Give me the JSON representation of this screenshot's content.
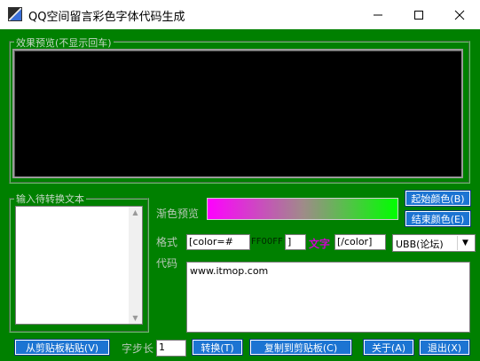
{
  "window": {
    "title": "QQ空间留言彩色字体代码生成",
    "icons": {
      "app": "app-icon",
      "minimize": "minimize-icon",
      "maximize": "maximize-icon",
      "close": "close-icon"
    }
  },
  "preview": {
    "group_label": "效果预览(不显示回车)"
  },
  "input": {
    "group_label": "输入待转换文本"
  },
  "gradient": {
    "label": "渐色预览",
    "start_color": "#ff00ff",
    "end_color": "#00ff00",
    "start_button": "起始颜色(B)",
    "end_button": "结束颜色(E)"
  },
  "format": {
    "label": "格式",
    "open_tag": "[color=#",
    "color_value": "FF00FF",
    "bracket": "]",
    "sample_text": "文字",
    "close_tag": "[/color]",
    "mode_selected": "UBB(论坛)"
  },
  "code": {
    "label": "代码",
    "value": "www.itmop.com"
  },
  "bottom": {
    "paste_button": "从剪贴板粘贴(V)",
    "step_label": "字步长",
    "step_value": "1",
    "convert_button": "转换(T)",
    "copy_button": "复制到剪贴板(C)",
    "about_button": "关于(A)",
    "exit_button": "退出(X)"
  },
  "colors": {
    "background": "#008000",
    "button": "#1c74d2",
    "sample_text": "#d000d0"
  }
}
